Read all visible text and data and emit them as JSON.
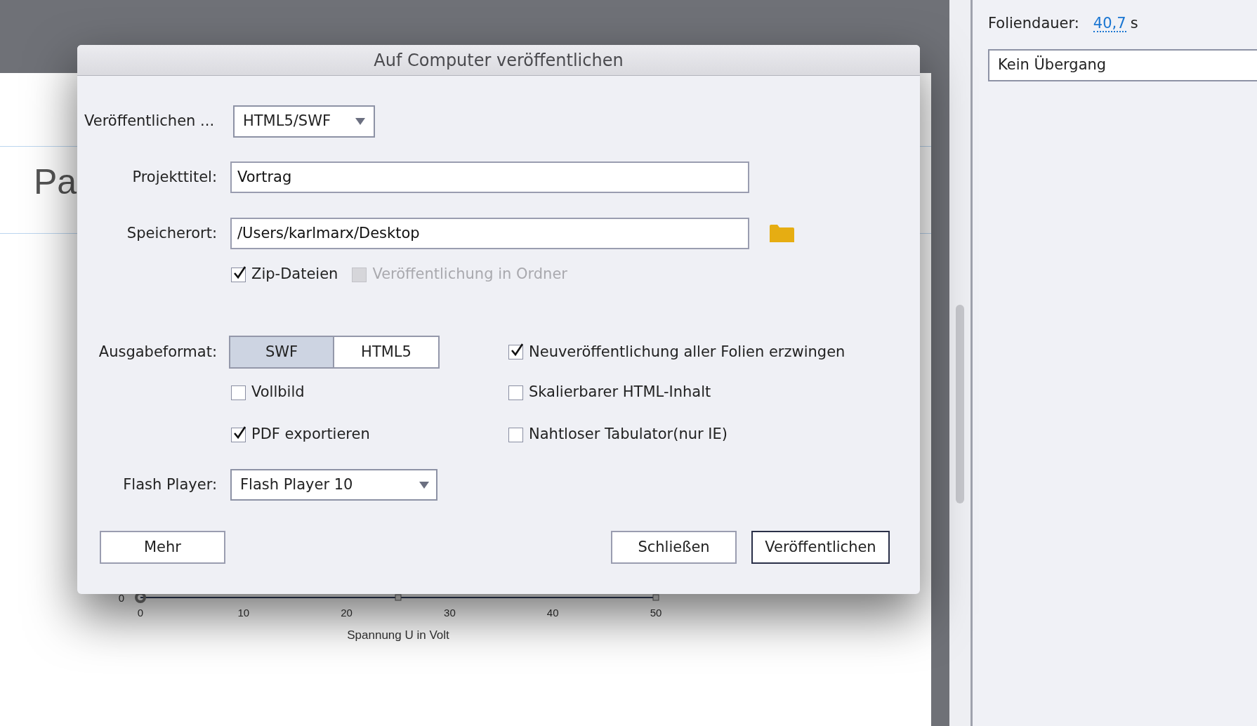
{
  "slide": {
    "title": "Pa",
    "chart": {
      "y_ticks": [
        "0"
      ],
      "x_ticks": [
        "0",
        "10",
        "20",
        "30",
        "40",
        "50"
      ],
      "x_label": "Spannung U in Volt"
    }
  },
  "dialog": {
    "title": "Auf Computer veröffentlichen",
    "publish_to": {
      "label": "Veröffentlichen ...",
      "value": "HTML5/SWF"
    },
    "project_title": {
      "label": "Projekttitel:",
      "value": "Vortrag"
    },
    "location": {
      "label": "Speicherort:",
      "value": "/Users/karlmarx/Desktop"
    },
    "location_options": [
      {
        "label": "Zip-Dateien",
        "checked": true,
        "disabled": false
      },
      {
        "label": "Veröffentlichung in Ordner",
        "checked": false,
        "disabled": true
      }
    ],
    "output_format": {
      "label": "Ausgabeformat:",
      "options": [
        {
          "label": "SWF",
          "selected": true
        },
        {
          "label": "HTML5",
          "selected": false
        }
      ]
    },
    "left_options": [
      {
        "label": "Vollbild",
        "checked": false
      },
      {
        "label": "PDF exportieren",
        "checked": true
      }
    ],
    "right_options": [
      {
        "label": "Neuveröffentlichung aller Folien erzwingen",
        "checked": true
      },
      {
        "label": "Skalierbarer HTML-Inhalt",
        "checked": false
      },
      {
        "label": "Nahtloser Tabulator(nur IE)",
        "checked": false
      }
    ],
    "flash_player": {
      "label": "Flash Player:",
      "value": "Flash Player 10"
    },
    "buttons": [
      {
        "label": "Mehr",
        "default": false
      },
      {
        "label": "Schließen",
        "default": false
      },
      {
        "label": "Veröffentlichen",
        "default": true
      }
    ]
  },
  "properties": {
    "duration_label": "Foliendauer:",
    "duration_value": "40,7",
    "duration_unit": "s",
    "transition": "Kein Übergang"
  }
}
